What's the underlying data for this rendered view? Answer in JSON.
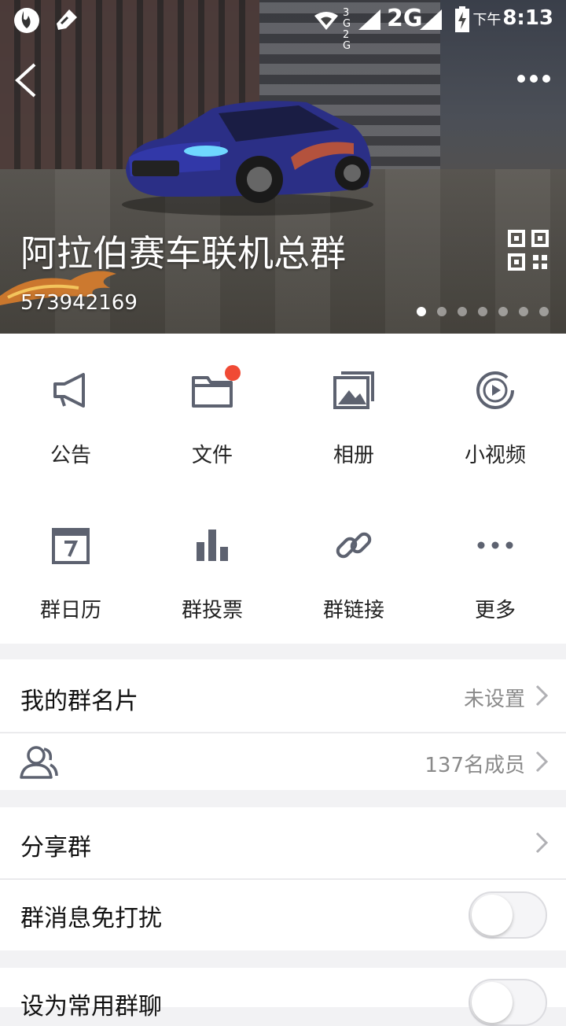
{
  "status_bar": {
    "network_small": "3G 2G",
    "network": "2G",
    "time_prefix": "下午",
    "time": "8:13"
  },
  "header": {
    "group_name": "阿拉伯赛车联机总群",
    "group_id": "573942169",
    "carousel": {
      "count": 7,
      "active": 1
    }
  },
  "features": [
    {
      "label": "公告",
      "icon": "megaphone-icon"
    },
    {
      "label": "文件",
      "icon": "folder-icon",
      "badge": true
    },
    {
      "label": "相册",
      "icon": "photo-album-icon"
    },
    {
      "label": "小视频",
      "icon": "video-play-icon"
    },
    {
      "label": "群日历",
      "icon": "calendar-icon"
    },
    {
      "label": "群投票",
      "icon": "bar-chart-icon"
    },
    {
      "label": "群链接",
      "icon": "link-icon"
    },
    {
      "label": "更多",
      "icon": "more-dots-icon"
    }
  ],
  "settings": {
    "my_card": {
      "title": "我的群名片",
      "value": "未设置"
    },
    "members": {
      "value": "137名成员"
    },
    "share": {
      "title": "分享群"
    },
    "mute": {
      "title": "群消息免打扰",
      "on": false
    },
    "favorite": {
      "title": "设为常用群聊",
      "on": false
    }
  },
  "colors": {
    "icon": "#5d6270",
    "badge": "#f04a35",
    "accent": "#fff"
  }
}
